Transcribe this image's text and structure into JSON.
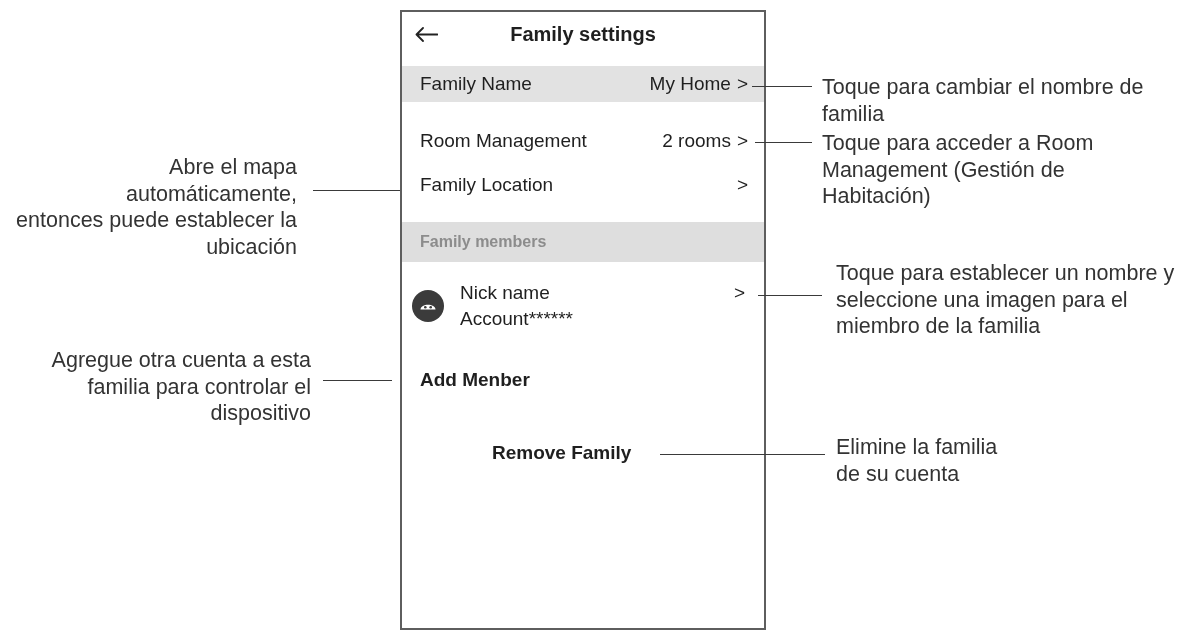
{
  "screen": {
    "title": "Family settings",
    "settings": [
      {
        "label": "Family Name",
        "value": "My Home",
        "chevron": ">",
        "selected": true
      },
      {
        "label": "Room Management",
        "value": "2 rooms",
        "chevron": ">",
        "selected": false
      },
      {
        "label": "Family Location",
        "chevron": ">",
        "selected": false
      }
    ],
    "members_section": {
      "title": "Family members",
      "members": [
        {
          "name": "Nick name",
          "account": "Account******",
          "chevron": ">"
        }
      ]
    },
    "add_member": "Add Menber",
    "remove_family": "Remove Family"
  },
  "annotations": [
    {
      "kind": "right",
      "text": "Toque para cambiar el nombre de\nfamilia"
    },
    {
      "kind": "right",
      "text": "Toque para acceder a Room\nManagement (Gestión de\nHabitación)"
    },
    {
      "kind": "left",
      "text": "Abre el mapa\nautomáticamente,\nentonces puede establecer la\nubicación"
    },
    {
      "kind": "right",
      "text": "Toque para establecer un nombre y\nseleccione una imagen para el\nmiembro de la familia"
    },
    {
      "kind": "left",
      "text": "Agregue otra cuenta a esta\nfamilia para controlar el\ndispositivo"
    },
    {
      "kind": "right",
      "text": "Elimine la familia\nde su cuenta"
    }
  ]
}
